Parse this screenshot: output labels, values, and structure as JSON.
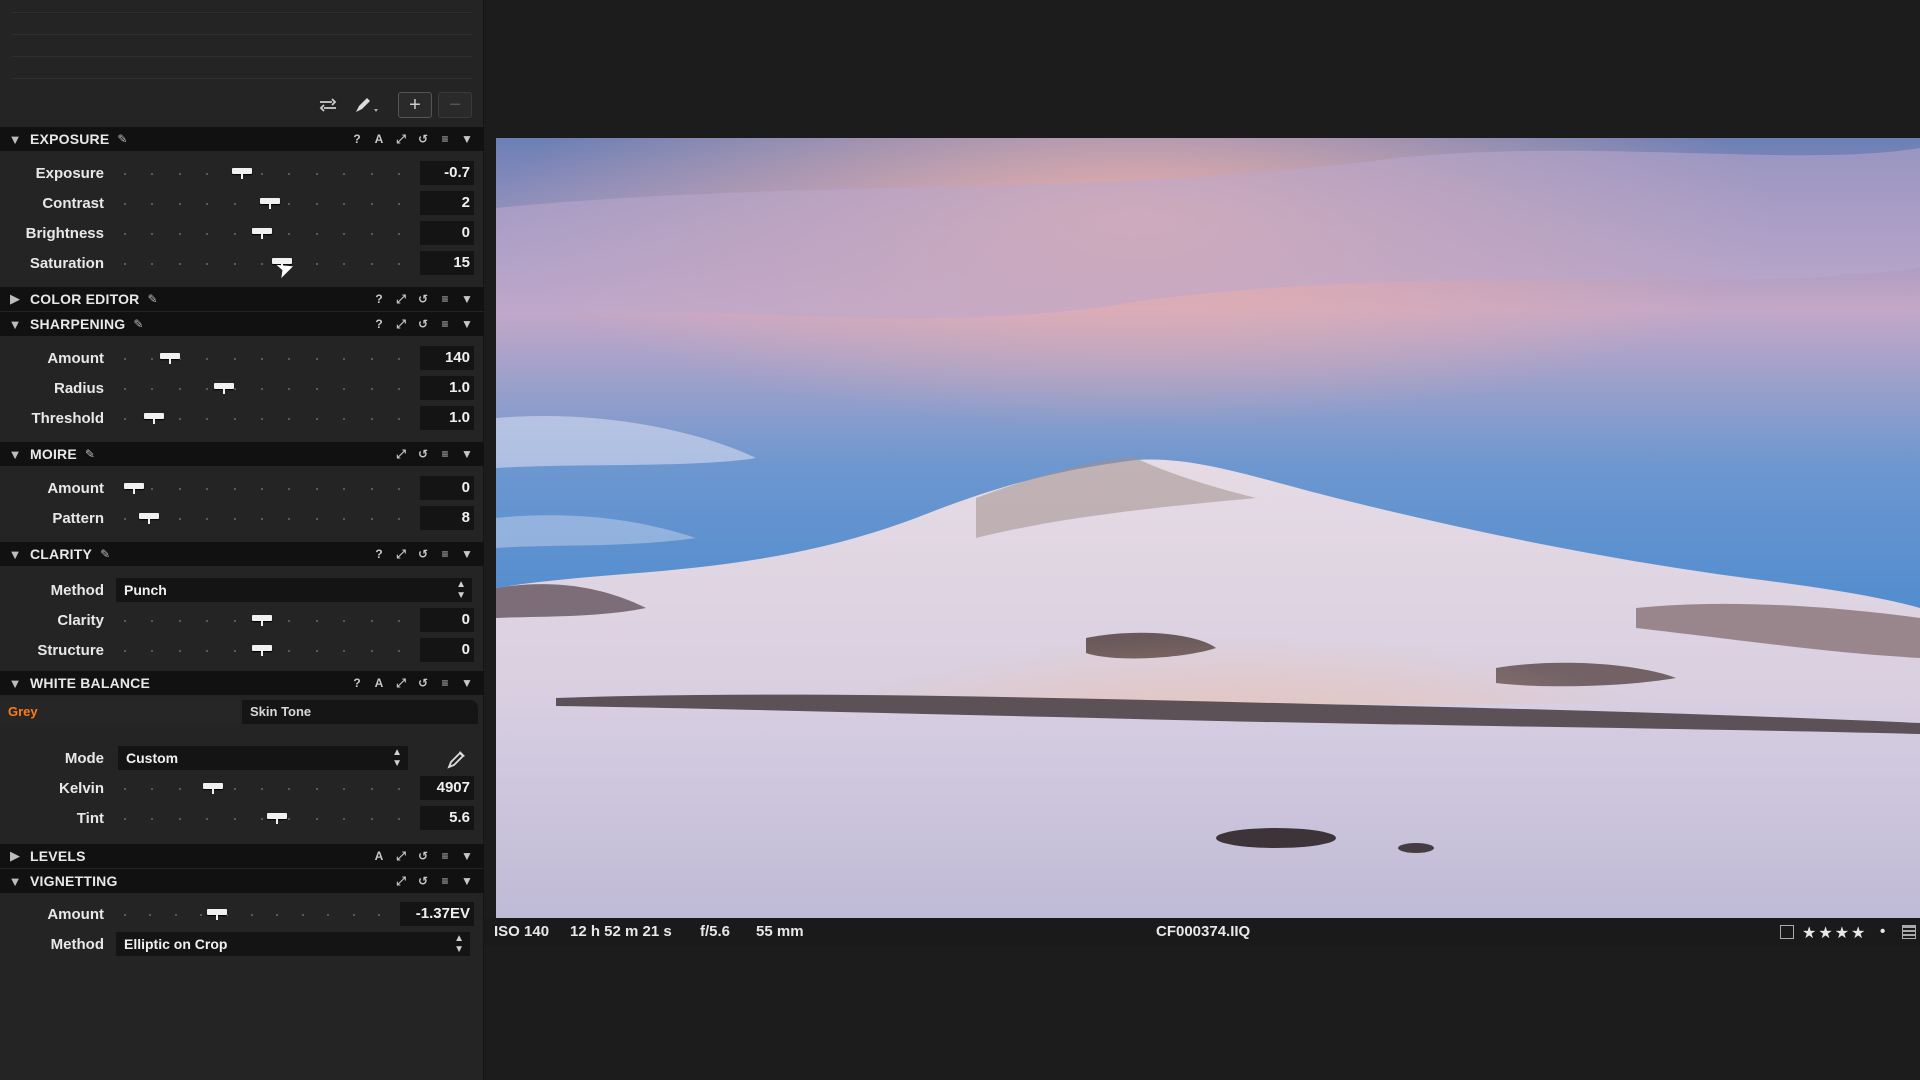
{
  "toolbar": {
    "add_label": "+",
    "remove_label": "−"
  },
  "exposure": {
    "title": "EXPOSURE",
    "sliders": [
      {
        "label": "Exposure",
        "value": "-0.7",
        "pos": 0.42
      },
      {
        "label": "Contrast",
        "value": "2",
        "pos": 0.53
      },
      {
        "label": "Brightness",
        "value": "0",
        "pos": 0.5
      },
      {
        "label": "Saturation",
        "value": "15",
        "pos": 0.58
      }
    ]
  },
  "color_editor": {
    "title": "COLOR EDITOR"
  },
  "sharpening": {
    "title": "SHARPENING",
    "sliders": [
      {
        "label": "Amount",
        "value": "140",
        "pos": 0.14
      },
      {
        "label": "Radius",
        "value": "1.0",
        "pos": 0.35
      },
      {
        "label": "Threshold",
        "value": "1.0",
        "pos": 0.08
      }
    ]
  },
  "moire": {
    "title": "MOIRE",
    "sliders": [
      {
        "label": "Amount",
        "value": "0",
        "pos": 0.0
      },
      {
        "label": "Pattern",
        "value": "8",
        "pos": 0.06
      }
    ]
  },
  "clarity": {
    "title": "CLARITY",
    "method_label": "Method",
    "method_value": "Punch",
    "sliders": [
      {
        "label": "Clarity",
        "value": "0",
        "pos": 0.5
      },
      {
        "label": "Structure",
        "value": "0",
        "pos": 0.5
      }
    ]
  },
  "white_balance": {
    "title": "WHITE BALANCE",
    "tab_grey": "Grey",
    "tab_skin": "Skin Tone",
    "mode_label": "Mode",
    "mode_value": "Custom",
    "sliders": [
      {
        "label": "Kelvin",
        "value": "4907",
        "pos": 0.31
      },
      {
        "label": "Tint",
        "value": "5.6",
        "pos": 0.56
      }
    ]
  },
  "levels": {
    "title": "LEVELS"
  },
  "vignetting": {
    "title": "VIGNETTING",
    "sliders": [
      {
        "label": "Amount",
        "value": "-1.37EV",
        "pos": 0.35
      }
    ],
    "method_label": "Method",
    "method_value": "Elliptic on Crop"
  },
  "status": {
    "iso": "ISO 140",
    "shutter": "12 h 52 m 21 s",
    "aperture": "f/5.6",
    "focal": "55 mm",
    "filename": "CF000374.IIQ",
    "stars": "★★★★",
    "rating": 4
  },
  "colors": {
    "accent_grey_tab": "#ff7a1a",
    "panel_bg": "#242424",
    "header_bg": "#111111"
  }
}
